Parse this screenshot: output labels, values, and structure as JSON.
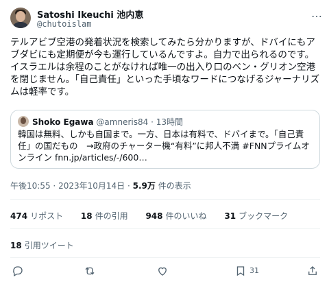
{
  "author": {
    "name": "Satoshi Ikeuchi 池内恵",
    "handle": "@chutoislam"
  },
  "post": {
    "text": "テルアビブ空港の発着状況を検索してみたら分かりますが、ドバイにもアブダビにも定期便が今も運行しているんですよ。自力で出られるのです。イスラエルは余程のことがなければ唯一の出入り口のベン・グリオン空港を閉じません。「自己責任」といった手頃なワードにつなげるジャーナリズムは軽率です。"
  },
  "quoted": {
    "name": "Shoko Egawa",
    "handle": "@amneris84",
    "time": "13時間",
    "text": "韓国は無料、しかも自国まで。一方、日本は有料で、ドバイまで。「自己責任」の国だもの　→政府のチャーター機“有料”に邦人不満 #FNNプライムオンライン fnn.jp/articles/-/600…"
  },
  "meta": {
    "time": "午後10:55",
    "date": "2023年10月14日",
    "views": "5.9万",
    "views_label": "件の表示"
  },
  "stats": [
    {
      "count": "474",
      "label": "リポスト"
    },
    {
      "count": "18",
      "label": "件の引用"
    },
    {
      "count": "948",
      "label": "件のいいね"
    },
    {
      "count": "31",
      "label": "ブックマーク"
    }
  ],
  "quote_tweets": {
    "count": "18",
    "label": "引用ツイート"
  },
  "actions": {
    "bookmark_count": "31"
  },
  "icons": [
    "more-icon",
    "reply-icon",
    "retweet-icon",
    "like-icon",
    "bookmark-icon",
    "share-icon"
  ]
}
